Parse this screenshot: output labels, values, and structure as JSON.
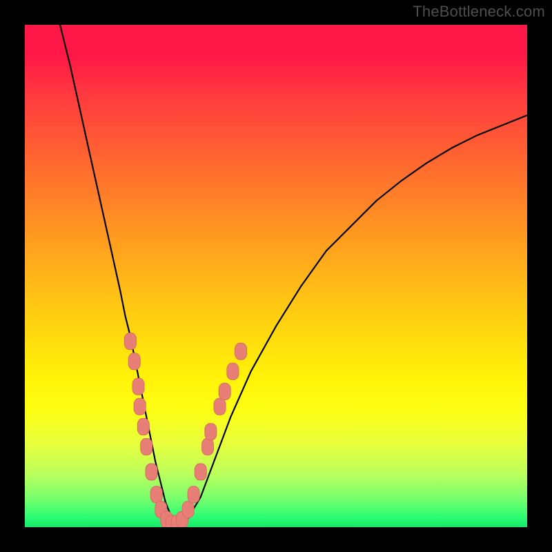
{
  "watermark": "TheBottleneck.com",
  "colors": {
    "frame": "#000000",
    "curve": "#000000",
    "marker_fill": "#e77f77",
    "marker_stroke": "#d86b63",
    "gradient_stops": [
      "#ff1747",
      "#ff3a3f",
      "#ff6a2f",
      "#ff9a20",
      "#ffc813",
      "#fff208",
      "#fcff14",
      "#e9ff3a",
      "#bfff5a",
      "#7dff6c",
      "#2bfc72",
      "#16e769"
    ]
  },
  "chart_data": {
    "type": "line",
    "title": "",
    "xlabel": "",
    "ylabel": "",
    "xlim": [
      0,
      100
    ],
    "ylim": [
      0,
      100
    ],
    "grid": false,
    "series": [
      {
        "name": "bottleneck-curve",
        "x": [
          7,
          9,
          11,
          13,
          15,
          17,
          19,
          20,
          21,
          22,
          23,
          24,
          25,
          26,
          27,
          28,
          29,
          30,
          31,
          32,
          35,
          38,
          41,
          45,
          50,
          55,
          60,
          65,
          70,
          75,
          80,
          85,
          90,
          95,
          100
        ],
        "y": [
          100,
          92,
          83,
          74,
          65,
          56,
          47,
          42,
          38,
          33,
          28,
          23,
          18,
          13,
          9,
          5,
          2.5,
          1,
          0.5,
          1,
          6,
          14,
          22,
          31,
          40,
          48,
          55,
          60,
          65,
          69,
          72.5,
          75.5,
          78,
          80,
          82
        ]
      }
    ],
    "markers": {
      "name": "highlighted-points",
      "points": [
        {
          "x": 21.0,
          "y": 37
        },
        {
          "x": 21.8,
          "y": 33
        },
        {
          "x": 22.6,
          "y": 28
        },
        {
          "x": 22.9,
          "y": 24
        },
        {
          "x": 23.6,
          "y": 20
        },
        {
          "x": 24.2,
          "y": 16
        },
        {
          "x": 25.2,
          "y": 11
        },
        {
          "x": 26.2,
          "y": 6.5
        },
        {
          "x": 27.1,
          "y": 3.5
        },
        {
          "x": 28.2,
          "y": 1.5
        },
        {
          "x": 29.2,
          "y": 0.7
        },
        {
          "x": 30.3,
          "y": 0.7
        },
        {
          "x": 31.3,
          "y": 1.5
        },
        {
          "x": 32.5,
          "y": 3.5
        },
        {
          "x": 33.6,
          "y": 6.5
        },
        {
          "x": 35.0,
          "y": 11
        },
        {
          "x": 36.4,
          "y": 16
        },
        {
          "x": 37.0,
          "y": 19
        },
        {
          "x": 38.8,
          "y": 24
        },
        {
          "x": 39.8,
          "y": 27
        },
        {
          "x": 41.4,
          "y": 31
        },
        {
          "x": 43.0,
          "y": 35
        }
      ]
    }
  }
}
